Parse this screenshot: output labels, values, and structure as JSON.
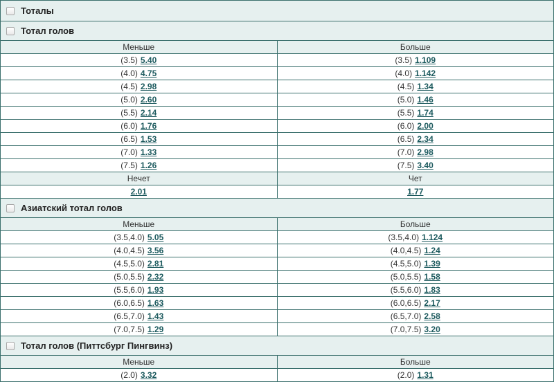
{
  "totals_header": "Тоталы",
  "sections": [
    {
      "title": "Тотал голов",
      "col_under": "Меньше",
      "col_over": "Больше",
      "rows": [
        {
          "u_line": "(3.5)",
          "u_odd": "5.40",
          "o_line": "(3.5)",
          "o_odd": "1.109"
        },
        {
          "u_line": "(4.0)",
          "u_odd": "4.75",
          "o_line": "(4.0)",
          "o_odd": "1.142"
        },
        {
          "u_line": "(4.5)",
          "u_odd": "2.98",
          "o_line": "(4.5)",
          "o_odd": "1.34"
        },
        {
          "u_line": "(5.0)",
          "u_odd": "2.60",
          "o_line": "(5.0)",
          "o_odd": "1.46"
        },
        {
          "u_line": "(5.5)",
          "u_odd": "2.14",
          "o_line": "(5.5)",
          "o_odd": "1.74"
        },
        {
          "u_line": "(6.0)",
          "u_odd": "1.76",
          "o_line": "(6.0)",
          "o_odd": "2.00"
        },
        {
          "u_line": "(6.5)",
          "u_odd": "1.53",
          "o_line": "(6.5)",
          "o_odd": "2.34"
        },
        {
          "u_line": "(7.0)",
          "u_odd": "1.33",
          "o_line": "(7.0)",
          "o_odd": "2.98"
        },
        {
          "u_line": "(7.5)",
          "u_odd": "1.26",
          "o_line": "(7.5)",
          "o_odd": "3.40"
        }
      ],
      "odd_even": {
        "odd_label": "Нечет",
        "odd_value": "2.01",
        "even_label": "Чет",
        "even_value": "1.77"
      }
    },
    {
      "title": "Азиатский тотал голов",
      "col_under": "Меньше",
      "col_over": "Больше",
      "rows": [
        {
          "u_line": "(3.5,4.0)",
          "u_odd": "5.05",
          "o_line": "(3.5,4.0)",
          "o_odd": "1.124"
        },
        {
          "u_line": "(4.0,4.5)",
          "u_odd": "3.56",
          "o_line": "(4.0,4.5)",
          "o_odd": "1.24"
        },
        {
          "u_line": "(4.5,5.0)",
          "u_odd": "2.81",
          "o_line": "(4.5,5.0)",
          "o_odd": "1.39"
        },
        {
          "u_line": "(5.0,5.5)",
          "u_odd": "2.32",
          "o_line": "(5.0,5.5)",
          "o_odd": "1.58"
        },
        {
          "u_line": "(5.5,6.0)",
          "u_odd": "1.93",
          "o_line": "(5.5,6.0)",
          "o_odd": "1.83"
        },
        {
          "u_line": "(6.0,6.5)",
          "u_odd": "1.63",
          "o_line": "(6.0,6.5)",
          "o_odd": "2.17"
        },
        {
          "u_line": "(6.5,7.0)",
          "u_odd": "1.43",
          "o_line": "(6.5,7.0)",
          "o_odd": "2.58"
        },
        {
          "u_line": "(7.0,7.5)",
          "u_odd": "1.29",
          "o_line": "(7.0,7.5)",
          "o_odd": "3.20"
        }
      ]
    },
    {
      "title": "Тотал голов (Питтсбург Пингвинз)",
      "col_under": "Меньше",
      "col_over": "Больше",
      "rows": [
        {
          "u_line": "(2.0)",
          "u_odd": "3.32",
          "o_line": "(2.0)",
          "o_odd": "1.31"
        }
      ]
    }
  ],
  "icons": {
    "checkbox": "checkbox-icon"
  },
  "colors": {
    "border": "#3a6f6c",
    "header_bg": "#e6f0ef",
    "odd_link": "#1c5a5e"
  }
}
